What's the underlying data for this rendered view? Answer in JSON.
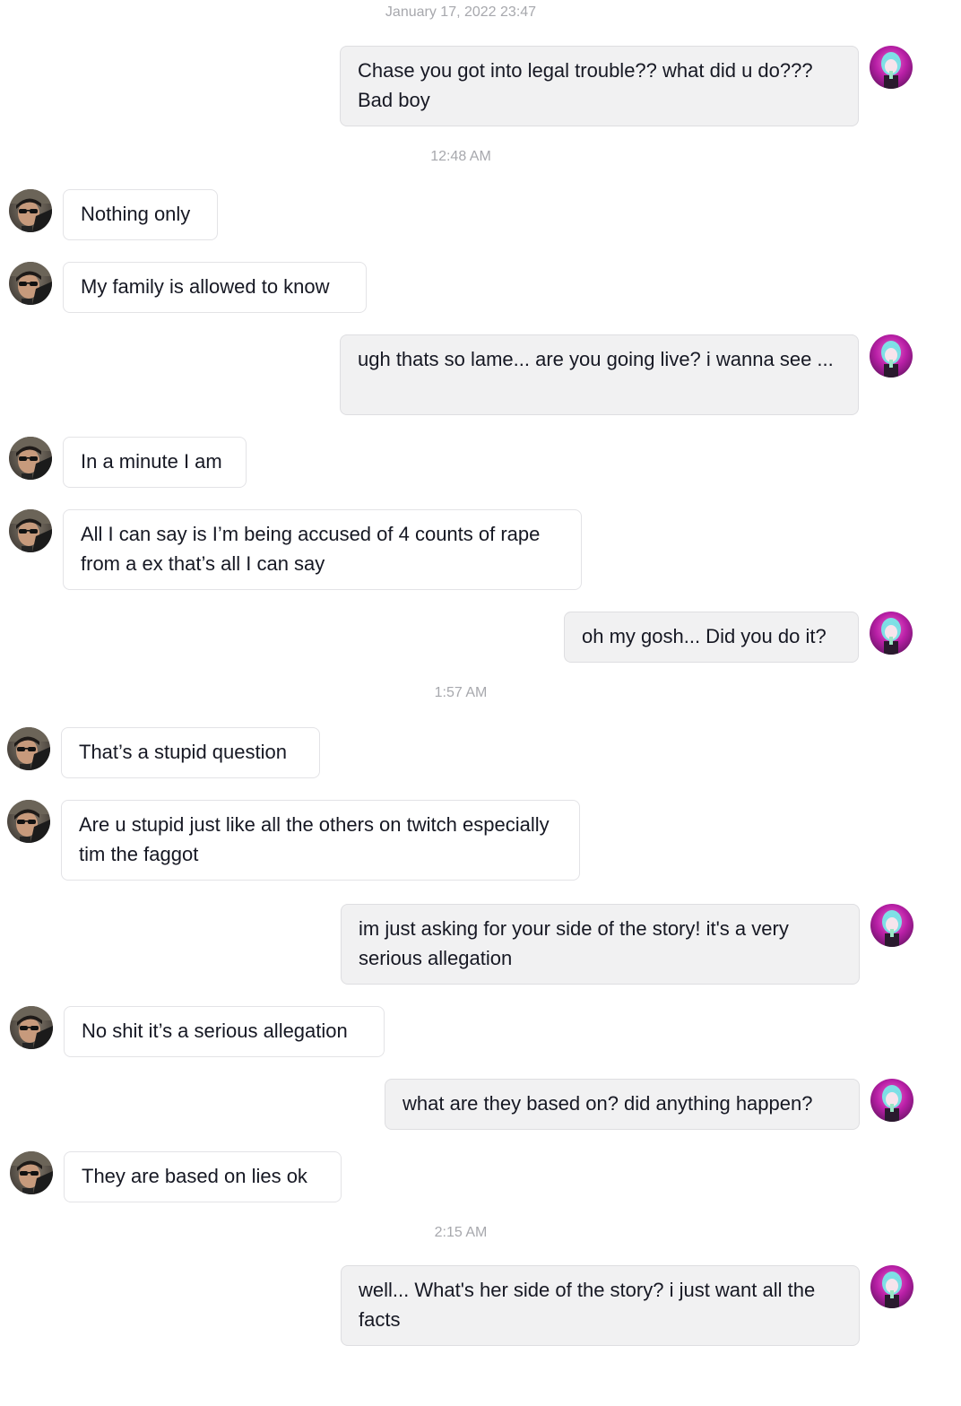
{
  "timestamps": {
    "t1": "January 17, 2022 23:47",
    "t2": "12:48 AM",
    "t3": "1:57 AM",
    "t4": "2:15 AM"
  },
  "avatars": {
    "me": "anime-girl-avatar",
    "them": "man-sunglasses-avatar"
  },
  "messages": [
    {
      "from": "me",
      "text": "Chase you got into legal trouble?? what did u do??? Bad boy"
    },
    {
      "from": "them",
      "text": "Nothing only"
    },
    {
      "from": "them",
      "text": "My family is allowed to know"
    },
    {
      "from": "me",
      "text": "ugh thats so lame... are you going live? i wanna see ..."
    },
    {
      "from": "them",
      "text": "In a minute I am"
    },
    {
      "from": "them",
      "text": "All I can say is I’m being accused of 4 counts of rape from a ex that’s all I can say"
    },
    {
      "from": "me",
      "text": "oh my gosh... Did you do it?"
    },
    {
      "from": "them",
      "text": "That’s a stupid question"
    },
    {
      "from": "them",
      "text": "Are u stupid just like all the others on twitch especially tim the faggot"
    },
    {
      "from": "me",
      "text": "im just asking for your side of the story! it's a very serious allegation"
    },
    {
      "from": "them",
      "text": "No shit it’s a serious allegation"
    },
    {
      "from": "me",
      "text": "what are they based on? did anything happen?"
    },
    {
      "from": "them",
      "text": "They are based on lies ok"
    },
    {
      "from": "me",
      "text": "well... What's her side of the story? i just want all the facts"
    }
  ]
}
